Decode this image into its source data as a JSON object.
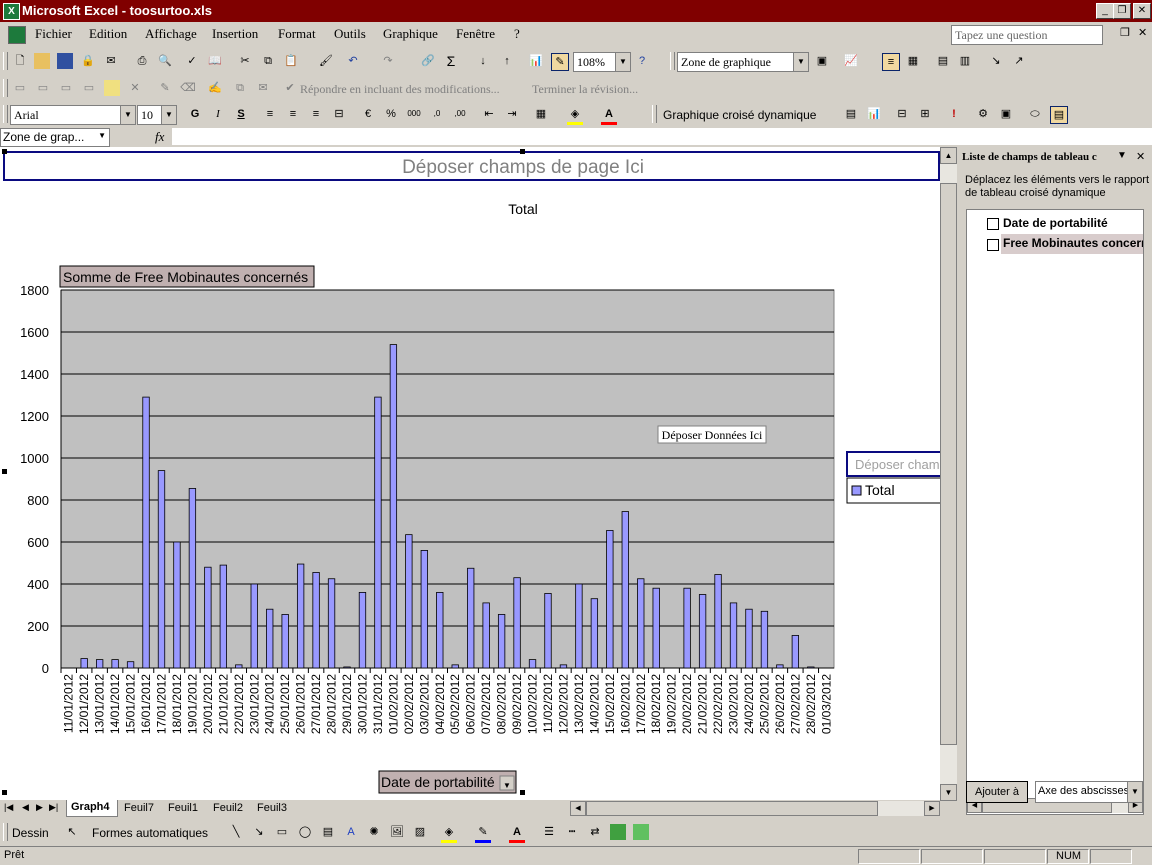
{
  "window": {
    "title": "Microsoft Excel - toosurtoo.xls",
    "help_box": "Tapez une question"
  },
  "menu": [
    "Fichier",
    "Edition",
    "Affichage",
    "Insertion",
    "Format",
    "Outils",
    "Graphique",
    "Fenêtre",
    "?"
  ],
  "toolbar1": {
    "zoom": "108%",
    "chart_object": "Zone de graphique"
  },
  "toolbar2": {
    "reply_text": "Répondre en incluant des modifications...",
    "end_review": "Terminer la révision..."
  },
  "toolbar3": {
    "font": "Arial",
    "size": "10",
    "bold": "G",
    "italic": "I",
    "underline": "S",
    "pivot_menu": "Graphique croisé dynamique"
  },
  "formula": {
    "name_box": "Zone de grap...",
    "fx": "fx"
  },
  "chart": {
    "page_field_drop": "Déposer champs de page Ici",
    "data_drop": "Déposer Données Ici",
    "data_field_button": "Somme de Free Mobinautes concernés",
    "category_field_button": "Date de portabilité",
    "series_drop": "Déposer champ",
    "legend_entry": "Total",
    "series_color": "#9999ff",
    "plot_bg": "#c0c0c0"
  },
  "chart_data": {
    "type": "bar",
    "title": "Total",
    "ylim": [
      0,
      1800
    ],
    "yticks": [
      0,
      200,
      400,
      600,
      800,
      1000,
      1200,
      1400,
      1600,
      1800
    ],
    "grid": true,
    "legend": "right",
    "categories": [
      "11/01/2012",
      "12/01/2012",
      "13/01/2012",
      "14/01/2012",
      "15/01/2012",
      "16/01/2012",
      "17/01/2012",
      "18/01/2012",
      "19/01/2012",
      "20/01/2012",
      "21/01/2012",
      "22/01/2012",
      "23/01/2012",
      "24/01/2012",
      "25/01/2012",
      "26/01/2012",
      "27/01/2012",
      "28/01/2012",
      "29/01/2012",
      "30/01/2012",
      "31/01/2012",
      "01/02/2012",
      "02/02/2012",
      "03/02/2012",
      "04/02/2012",
      "05/02/2012",
      "06/02/2012",
      "07/02/2012",
      "08/02/2012",
      "09/02/2012",
      "10/02/2012",
      "11/02/2012",
      "12/02/2012",
      "13/02/2012",
      "14/02/2012",
      "15/02/2012",
      "16/02/2012",
      "17/02/2012",
      "18/02/2012",
      "19/02/2012",
      "20/02/2012",
      "21/02/2012",
      "22/02/2012",
      "23/02/2012",
      "24/02/2012",
      "25/02/2012",
      "26/02/2012",
      "27/02/2012",
      "28/02/2012",
      "01/03/2012"
    ],
    "series": [
      {
        "name": "Total",
        "values": [
          0,
          45,
          40,
          40,
          30,
          1290,
          940,
          600,
          855,
          480,
          490,
          15,
          400,
          280,
          255,
          495,
          455,
          425,
          5,
          360,
          1290,
          1540,
          635,
          560,
          360,
          15,
          475,
          310,
          255,
          430,
          40,
          355,
          15,
          400,
          330,
          655,
          745,
          425,
          380,
          0,
          380,
          350,
          445,
          310,
          280,
          270,
          15,
          155,
          5,
          0
        ]
      }
    ]
  },
  "taskpane": {
    "title": "Liste de champs de tableau c",
    "instructions": "Déplacez les éléments vers le rapport de tableau croisé dynamique",
    "fields": [
      "Date de portabilité",
      "Free Mobinautes concern"
    ],
    "add_button": "Ajouter à",
    "target": "Axe des abscisses"
  },
  "sheet_tabs": [
    "Graph4",
    "Feuil7",
    "Feuil1",
    "Feuil2",
    "Feuil3"
  ],
  "drawing": {
    "draw_menu": "Dessin",
    "autoshapes": "Formes automatiques"
  },
  "status": {
    "ready": "Prêt",
    "num": "NUM"
  }
}
